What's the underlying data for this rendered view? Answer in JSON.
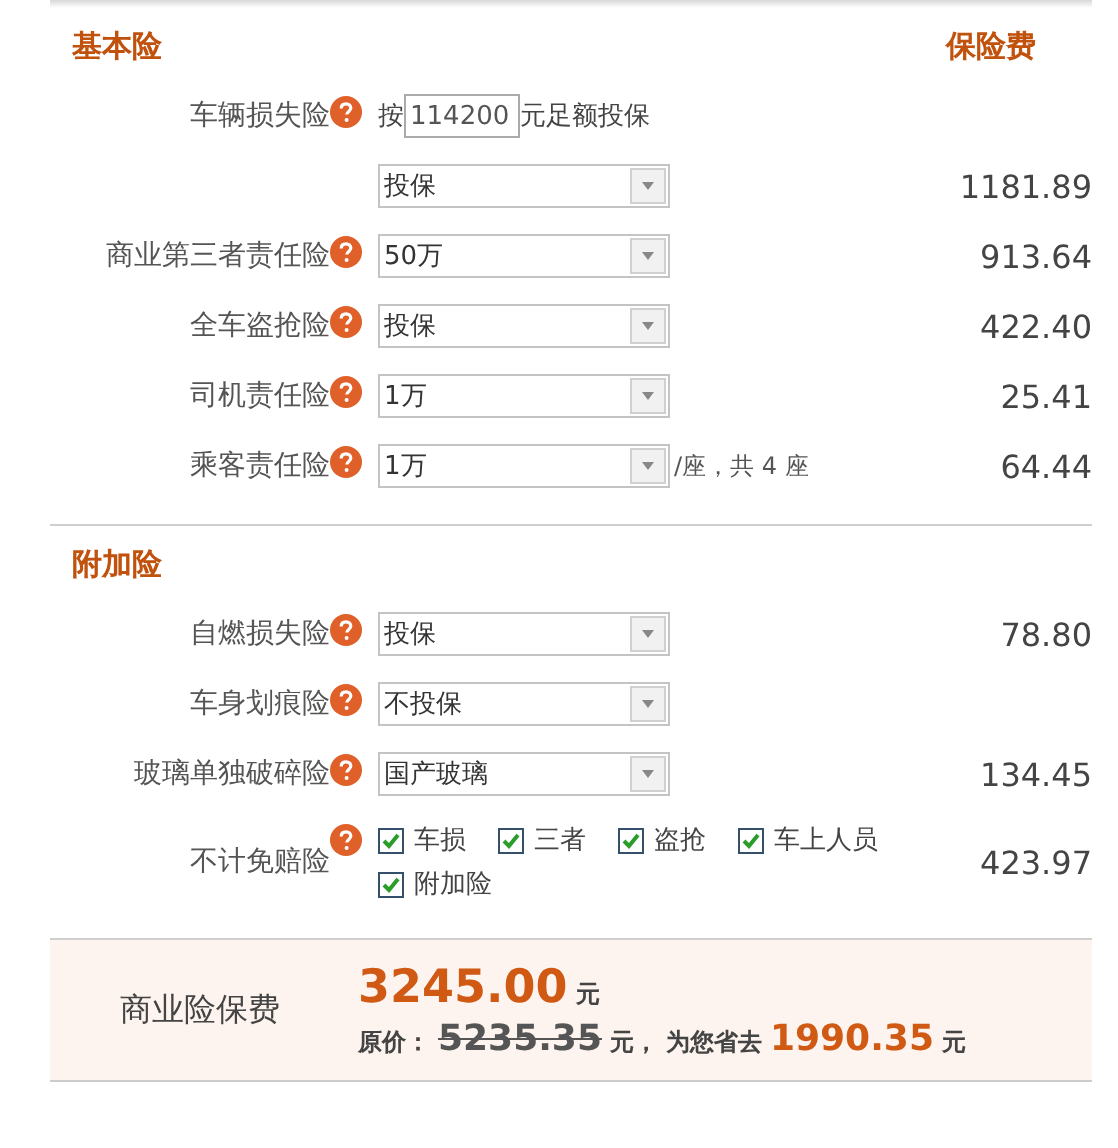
{
  "sections": [
    {
      "title": "基本险",
      "price_heading": "保险费",
      "rows": [
        {
          "kind": "amount",
          "label": "车辆损失险",
          "help": true,
          "prefix": "按",
          "value": "114200",
          "suffix": "元足额投保"
        },
        {
          "kind": "select",
          "value": "投保",
          "price": "1181.89"
        },
        {
          "kind": "select",
          "label": "商业第三者责任险",
          "help": true,
          "value": "50万",
          "price": "913.64"
        },
        {
          "kind": "select",
          "label": "全车盗抢险",
          "help": true,
          "value": "投保",
          "price": "422.40"
        },
        {
          "kind": "select",
          "label": "司机责任险",
          "help": true,
          "value": "1万",
          "price": "25.41"
        },
        {
          "kind": "select",
          "label": "乘客责任险",
          "help": true,
          "value": "1万",
          "note": "/座，共 4 座",
          "price": "64.44"
        }
      ]
    },
    {
      "title": "附加险",
      "rows": [
        {
          "kind": "select",
          "label": "自燃损失险",
          "help": true,
          "value": "投保",
          "price": "78.80"
        },
        {
          "kind": "select",
          "label": "车身划痕险",
          "help": true,
          "value": "不投保"
        },
        {
          "kind": "select",
          "label": "玻璃单独破碎险",
          "help": true,
          "value": "国产玻璃",
          "price": "134.45"
        },
        {
          "kind": "checkboxes",
          "label": "不计免赔险",
          "help": true,
          "price": "423.97",
          "options": [
            {
              "label": "车损",
              "checked": true
            },
            {
              "label": "三者",
              "checked": true
            },
            {
              "label": "盗抢",
              "checked": true
            },
            {
              "label": "车上人员",
              "checked": true
            },
            {
              "label": "附加险",
              "checked": true
            }
          ]
        }
      ]
    }
  ],
  "summary": {
    "label": "商业险保费",
    "total": "3245.00",
    "total_unit": "元",
    "original_label": "原价：",
    "original": "5235.35",
    "original_unit": "元，",
    "saved_label": "为您省去",
    "saved": "1990.35",
    "saved_unit": "元"
  }
}
